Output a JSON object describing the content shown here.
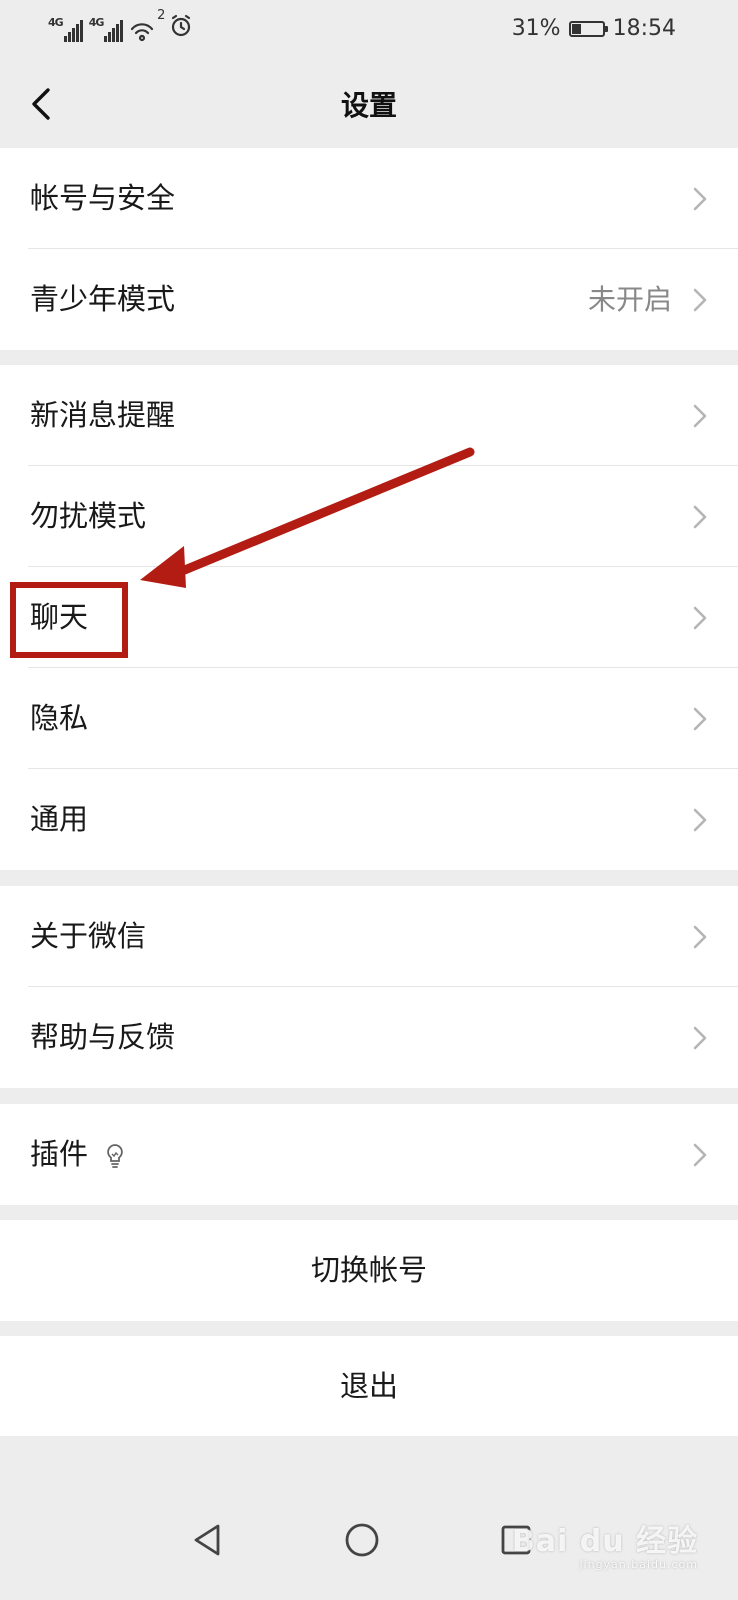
{
  "status_bar": {
    "net1": "4G",
    "net2": "4G",
    "hotspot_count": "2",
    "battery_percent": "31%",
    "time": "18:54",
    "battery_level": 0.31
  },
  "nav": {
    "title": "设置",
    "back_icon": "chevron-left-icon"
  },
  "groups": [
    {
      "items": [
        {
          "label": "帐号与安全",
          "value": ""
        },
        {
          "label": "青少年模式",
          "value": "未开启"
        }
      ]
    },
    {
      "items": [
        {
          "label": "新消息提醒",
          "value": ""
        },
        {
          "label": "勿扰模式",
          "value": ""
        },
        {
          "label": "聊天",
          "value": ""
        },
        {
          "label": "隐私",
          "value": ""
        },
        {
          "label": "通用",
          "value": ""
        }
      ]
    },
    {
      "items": [
        {
          "label": "关于微信",
          "value": ""
        },
        {
          "label": "帮助与反馈",
          "value": ""
        }
      ]
    },
    {
      "items": [
        {
          "label": "插件",
          "value": "",
          "icon": "lightbulb-icon"
        }
      ]
    }
  ],
  "actions": {
    "switch_account": "切换帐号",
    "logout": "退出"
  },
  "system_nav": {
    "back": "triangle-back-icon",
    "home": "circle-home-icon",
    "recents": "square-recents-icon"
  },
  "watermark": {
    "brand": "Bai du 经验",
    "sub": "jingyan.baidu.com"
  },
  "annotation": {
    "color": "#b31c13",
    "target": "聊天"
  }
}
